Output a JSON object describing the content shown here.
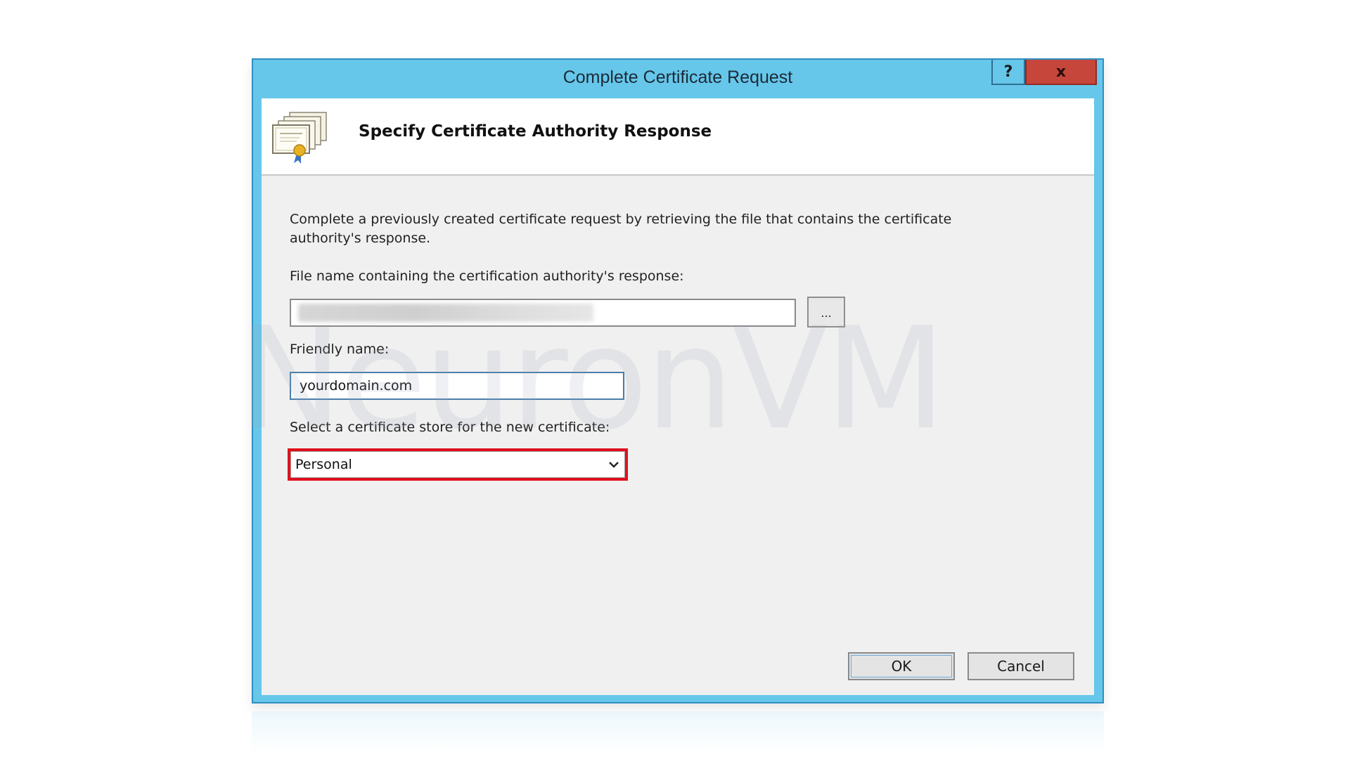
{
  "window": {
    "title": "Complete Certificate Request",
    "help_label": "?",
    "close_label": "x"
  },
  "header": {
    "title": "Specify Certificate Authority Response",
    "icon": "certificate-icon"
  },
  "description": "Complete a previously created certificate request by retrieving the file that contains the certificate authority's response.",
  "file_field": {
    "label": "File name containing the certification authority's response:",
    "value": "",
    "browse_label": "..."
  },
  "friendly_name": {
    "label": "Friendly name:",
    "value": "yourdomain.com"
  },
  "store": {
    "label": "Select a certificate store for the new certificate:",
    "selected": "Personal",
    "highlight_color": "#e0101d"
  },
  "buttons": {
    "ok_label": "OK",
    "cancel_label": "Cancel"
  },
  "watermark": {
    "text": "NeuronVM"
  },
  "colors": {
    "titlebar": "#66c7ea",
    "close": "#c7463b",
    "client_bg": "#f0f0f0"
  }
}
